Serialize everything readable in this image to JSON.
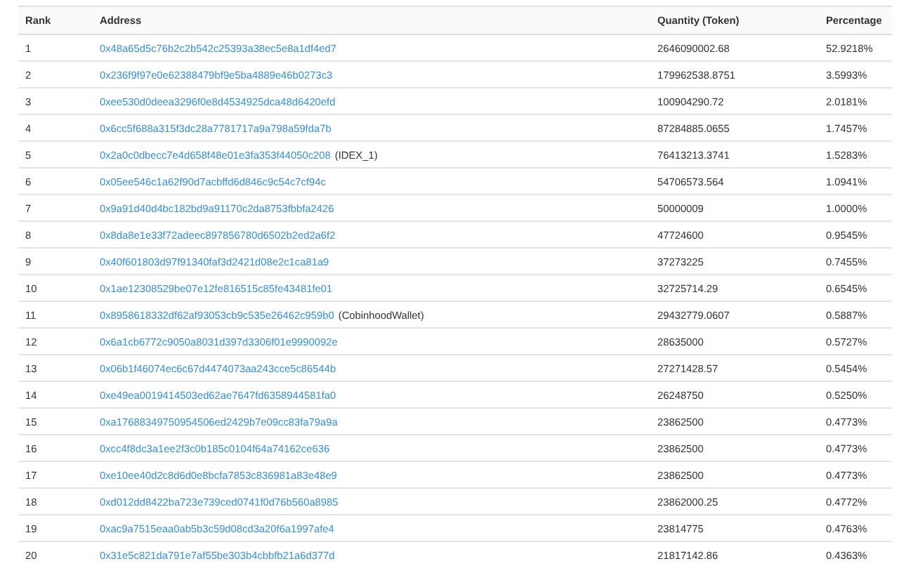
{
  "table": {
    "columns": [
      "Rank",
      "Address",
      "Quantity (Token)",
      "Percentage"
    ],
    "rows": [
      {
        "rank": "1",
        "address": "0x48a65d5c76b2c2b542c25393a38ec5e8a1df4ed7",
        "quantity": "2646090002.68",
        "percentage": "52.9218%"
      },
      {
        "rank": "2",
        "address": "0x236f9f97e0e62388479bf9e5ba4889e46b0273c3",
        "quantity": "179962538.8751",
        "percentage": "3.5993%"
      },
      {
        "rank": "3",
        "address": "0xee530d0deea3296f0e8d4534925dca48d6420efd",
        "quantity": "100904290.72",
        "percentage": "2.0181%"
      },
      {
        "rank": "4",
        "address": "0x6cc5f688a315f3dc28a7781717a9a798a59fda7b",
        "quantity": "87284885.0655",
        "percentage": "1.7457%"
      },
      {
        "rank": "5",
        "address": "0x2a0c0dbecc7e4d658f48e01e3fa353f44050c208",
        "tag": "(IDEX_1)",
        "quantity": "76413213.3741",
        "percentage": "1.5283%"
      },
      {
        "rank": "6",
        "address": "0x05ee546c1a62f90d7acbffd6d846c9c54c7cf94c",
        "quantity": "54706573.564",
        "percentage": "1.0941%"
      },
      {
        "rank": "7",
        "address": "0x9a91d40d4bc182bd9a91170c2da8753fbbfa2426",
        "quantity": "50000009",
        "percentage": "1.0000%"
      },
      {
        "rank": "8",
        "address": "0x8da8e1e33f72adeec897856780d6502b2ed2a6f2",
        "quantity": "47724600",
        "percentage": "0.9545%"
      },
      {
        "rank": "9",
        "address": "0x40f601803d97f91340faf3d2421d08e2c1ca81a9",
        "quantity": "37273225",
        "percentage": "0.7455%"
      },
      {
        "rank": "10",
        "address": "0x1ae12308529be07e12fe816515c85fe43481fe01",
        "quantity": "32725714.29",
        "percentage": "0.6545%"
      },
      {
        "rank": "11",
        "address": "0x8958618332df62af93053cb9c535e26462c959b0",
        "tag": "(CobinhoodWallet)",
        "quantity": "29432779.0607",
        "percentage": "0.5887%"
      },
      {
        "rank": "12",
        "address": "0x6a1cb6772c9050a8031d397d3306f01e9990092e",
        "quantity": "28635000",
        "percentage": "0.5727%"
      },
      {
        "rank": "13",
        "address": "0x06b1f46074ec6c67d4474073aa243cce5c86544b",
        "quantity": "27271428.57",
        "percentage": "0.5454%"
      },
      {
        "rank": "14",
        "address": "0xe49ea0019414503ed62ae7647fd6358944581fa0",
        "quantity": "26248750",
        "percentage": "0.5250%"
      },
      {
        "rank": "15",
        "address": "0xa17688349750954506ed2429b7e09cc83fa79a9a",
        "quantity": "23862500",
        "percentage": "0.4773%"
      },
      {
        "rank": "16",
        "address": "0xcc4f8dc3a1ee2f3c0b185c0104f64a74162ce636",
        "quantity": "23862500",
        "percentage": "0.4773%"
      },
      {
        "rank": "17",
        "address": "0xe10ee40d2c8d6d0e8bcfa7853c836981a83e48e9",
        "quantity": "23862500",
        "percentage": "0.4773%"
      },
      {
        "rank": "18",
        "address": "0xd012dd8422ba723e739ced0741f0d76b560a8985",
        "quantity": "23862000.25",
        "percentage": "0.4772%"
      },
      {
        "rank": "19",
        "address": "0xac9a7515eaa0ab5b3c59d08cd3a20f6a1997afe4",
        "quantity": "23814775",
        "percentage": "0.4763%"
      },
      {
        "rank": "20",
        "address": "0x31e5c821da791e7af55be303b4cbbfb21a6d377d",
        "quantity": "21817142.86",
        "percentage": "0.4363%"
      }
    ]
  }
}
